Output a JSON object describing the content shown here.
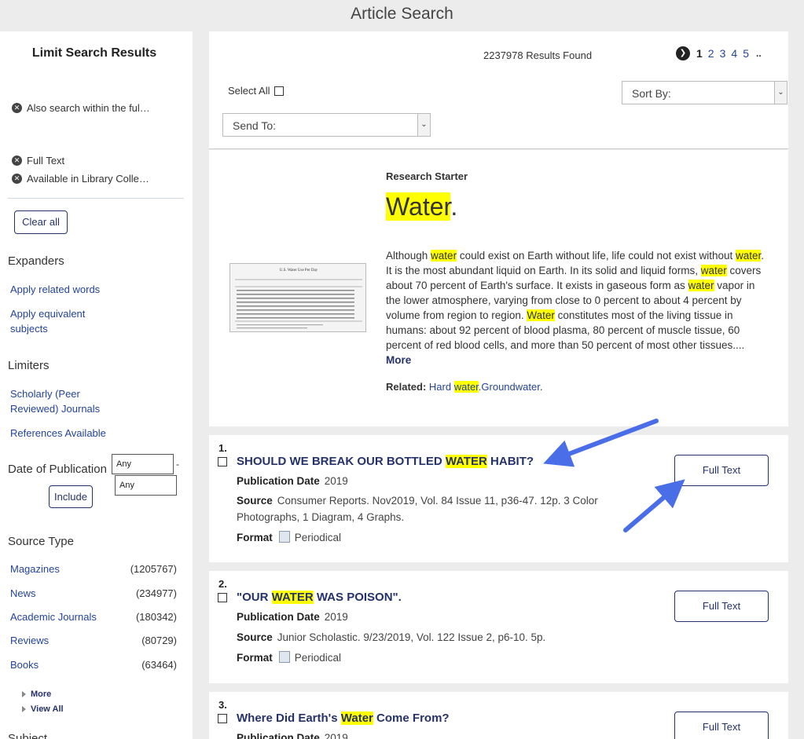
{
  "page": {
    "title": "Article Search"
  },
  "sidebar": {
    "title": "Limit Search Results",
    "applied_filters": [
      "Also search within the ful…",
      "Full Text",
      "Available in Library Colle…"
    ],
    "clear_all": "Clear all",
    "expanders": {
      "heading": "Expanders",
      "items": [
        "Apply related words",
        "Apply equivalent subjects"
      ]
    },
    "limiters": {
      "heading": "Limiters",
      "items": [
        "Scholarly (Peer Reviewed) Journals",
        "References Available"
      ]
    },
    "date": {
      "label": "Date of Publication",
      "from": "Any",
      "to": "Any",
      "separator": "-",
      "include": "Include"
    },
    "source_type": {
      "heading": "Source Type",
      "items": [
        {
          "label": "Magazines",
          "count": "(1205767)"
        },
        {
          "label": "News",
          "count": "(234977)"
        },
        {
          "label": "Academic Journals",
          "count": "(180342)"
        },
        {
          "label": "Reviews",
          "count": "(80729)"
        },
        {
          "label": "Books",
          "count": "(63464)"
        }
      ],
      "more": "More",
      "view_all": "View All"
    },
    "next_heading": "Subject"
  },
  "toolbar": {
    "results_found": "2237978 Results Found",
    "pages": [
      "1",
      "2",
      "3",
      "4",
      "5"
    ],
    "current_page": "1",
    "ellipsis": "..",
    "select_all": "Select All",
    "sort_by": "Sort By:",
    "send_to": "Send To:"
  },
  "research_starter": {
    "label": "Research Starter",
    "title_highlight": "Water",
    "title_suffix": ".",
    "thumbnail_caption": "U.S. Water Use Per Day",
    "body": [
      {
        "t": "Although "
      },
      {
        "h": "water"
      },
      {
        "t": " could exist on Earth without life, life could not exist without "
      },
      {
        "h": "water"
      },
      {
        "t": ". It is the most abundant liquid on Earth. In its solid and liquid forms, "
      },
      {
        "h": "water"
      },
      {
        "t": " covers about 70 percent of Earth's surface. It exists in gaseous form as "
      },
      {
        "h": "water"
      },
      {
        "t": " vapor in the lower atmosphere, varying from close to 0 percent to about 4 percent by volume from region to region. "
      },
      {
        "h": "Water"
      },
      {
        "t": " constitutes most of the living tissue in humans: about 92 percent of blood plasma, 80 percent of muscle tissue, 60 percent of red blood cells, and more than 50 percent of most other tissues.... "
      }
    ],
    "more": "More",
    "related_label": "Related:",
    "related_1_pre": "Hard ",
    "related_1_hl": "water",
    "related_2": ".Groundwater",
    "related_end": "."
  },
  "results": [
    {
      "num": "1.",
      "title_pre": "SHOULD WE BREAK OUR BOTTLED ",
      "title_hl": "WATER",
      "title_post": " HABIT?",
      "date_label": "Publication Date",
      "date": "2019",
      "source_label": "Source",
      "source": "Consumer Reports. Nov2019, Vol. 84 Issue 11, p36-47. 12p. 3 Color Photographs, 1 Diagram, 4 Graphs.",
      "format_label": "Format",
      "format": "Periodical",
      "full_text": "Full Text"
    },
    {
      "num": "2.",
      "title_pre": "\"OUR ",
      "title_hl": "WATER",
      "title_post": " WAS POISON\".",
      "date_label": "Publication Date",
      "date": "2019",
      "source_label": "Source",
      "source": "Junior Scholastic. 9/23/2019, Vol. 122 Issue 2, p6-10. 5p.",
      "format_label": "Format",
      "format": "Periodical",
      "full_text": "Full Text"
    },
    {
      "num": "3.",
      "title_pre": "Where Did Earth's ",
      "title_hl": "Water",
      "title_post": " Come From?",
      "date_label": "Publication Date",
      "date": "2019",
      "full_text": "Full Text"
    }
  ],
  "colors": {
    "link": "#24449a",
    "navy": "#25326a",
    "highlight": "#ffff00",
    "annotation_arrow": "#4a6ee8"
  }
}
